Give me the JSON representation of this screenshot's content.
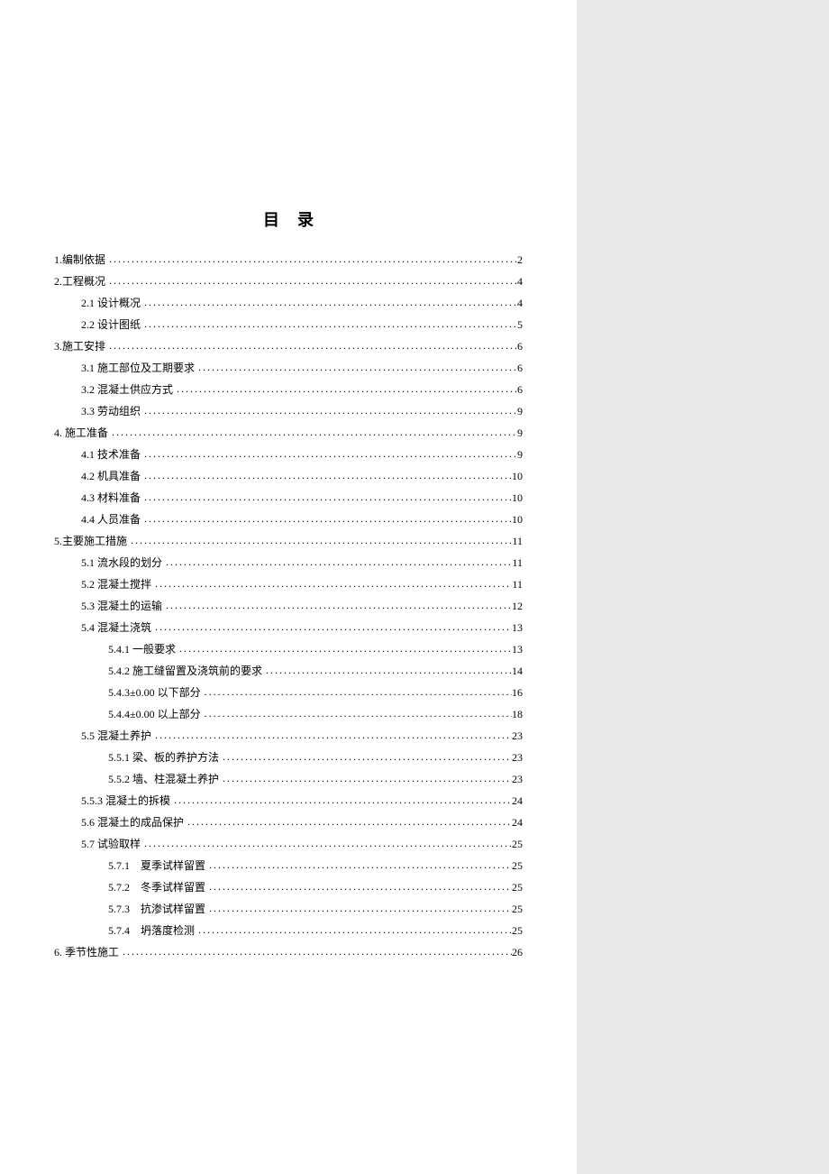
{
  "title": "目录",
  "entries": [
    {
      "level": 0,
      "label": "1.编制依据 ",
      "page": "2"
    },
    {
      "level": 0,
      "label": "2.工程概况 ",
      "page": "4"
    },
    {
      "level": 1,
      "label": "2.1 设计概况 ",
      "page": "4"
    },
    {
      "level": 1,
      "label": "2.2 设计图纸 ",
      "page": "5"
    },
    {
      "level": 0,
      "label": "3.施工安排 ",
      "page": "6"
    },
    {
      "level": 1,
      "label": "3.1 施工部位及工期要求 ",
      "page": "6"
    },
    {
      "level": 1,
      "label": "3.2 混凝土供应方式 ",
      "page": "6"
    },
    {
      "level": 1,
      "label": "3.3 劳动组织 ",
      "page": "9"
    },
    {
      "level": 0,
      "label": "4. 施工准备 ",
      "page": "9"
    },
    {
      "level": 1,
      "label": "4.1 技术准备 ",
      "page": "9"
    },
    {
      "level": 1,
      "label": "4.2 机具准备 ",
      "page": "10"
    },
    {
      "level": 1,
      "label": "4.3 材料准备 ",
      "page": "10"
    },
    {
      "level": 1,
      "label": "4.4 人员准备 ",
      "page": "10"
    },
    {
      "level": 0,
      "label": "5.主要施工措施 ",
      "page": "11"
    },
    {
      "level": 1,
      "label": "5.1 流水段的划分 ",
      "page": "11"
    },
    {
      "level": 1,
      "label": "5.2 混凝土搅拌 ",
      "page": "11"
    },
    {
      "level": 1,
      "label": "5.3 混凝土的运输 ",
      "page": "12"
    },
    {
      "level": 1,
      "label": "5.4 混凝土浇筑 ",
      "page": "13"
    },
    {
      "level": 2,
      "label": "5.4.1 一般要求",
      "page": "13"
    },
    {
      "level": 2,
      "label": "5.4.2 施工缝留置及浇筑前的要求",
      "page": "14"
    },
    {
      "level": 2,
      "label": "5.4.3±0.00 以下部分",
      "page": "16"
    },
    {
      "level": 2,
      "label": "5.4.4±0.00 以上部分",
      "page": "18"
    },
    {
      "level": 1,
      "label": "5.5 混凝土养护 ",
      "page": "23"
    },
    {
      "level": 2,
      "label": "5.5.1 梁、板的养护方法",
      "page": "23"
    },
    {
      "level": 2,
      "label": "5.5.2 墙、柱混凝土养护",
      "page": "23"
    },
    {
      "level": 1,
      "label": "5.5.3 混凝土的拆模 ",
      "page": "24"
    },
    {
      "level": 1,
      "label": "5.6 混凝土的成品保护 ",
      "page": "24"
    },
    {
      "level": 1,
      "label": "5.7 试验取样 ",
      "page": "25"
    },
    {
      "level": 2,
      "label": "5.7.1　夏季试样留置 ",
      "page": "25"
    },
    {
      "level": 2,
      "label": "5.7.2　冬季试样留置 ",
      "page": "25"
    },
    {
      "level": 2,
      "label": "5.7.3　抗渗试样留置 ",
      "page": "25"
    },
    {
      "level": 2,
      "label": "5.7.4　坍落度检测 ",
      "page": "25"
    },
    {
      "level": 0,
      "label": "6. 季节性施工 ",
      "page": "26"
    }
  ]
}
